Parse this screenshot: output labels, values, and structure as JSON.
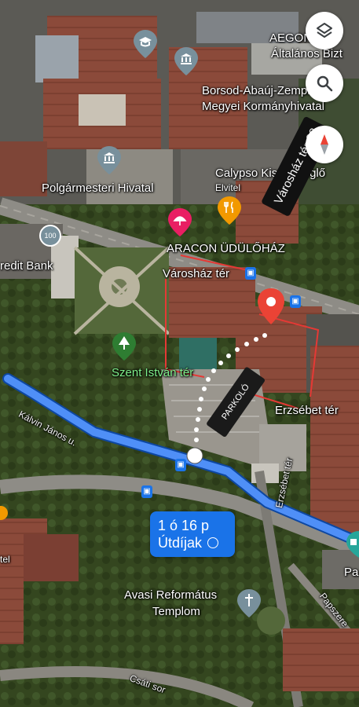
{
  "map": {
    "place_labels": {
      "aego": "AEGON",
      "altalanos": "Általános Bizt",
      "borsod_1": "Borsod-Abaúj-Zemple",
      "borsod_2": "Megyei Kormányhivatal",
      "calypso": "Calypso Kisvendéglő",
      "elvitel": "Elvitel",
      "polgarmesteri": "Polgármesteri Hivatal",
      "aracon": "ARACON ÜDÜLŐHÁZ",
      "varoshaz_ter": "Városház tér",
      "credit_bank": "redit Bank",
      "szent_istvan": "Szent István tér",
      "erzsebet_ter": "Erzsébet tér",
      "avasi_1": "Avasi Református",
      "avasi_2": "Templom",
      "pa": "Pa",
      "tel": "tel"
    },
    "road_labels": {
      "kalvin": "Kálvin János u.",
      "erzsebet_road": "Erzsébet tér",
      "papszer": "Papszere",
      "csati": "Csáti sor"
    },
    "annotations": {
      "varoshaz_22": "Városház tér 22",
      "parkolo": "PARKOLÓ"
    },
    "bank_badge": "100",
    "route": {
      "time": "1 ó 16 p",
      "tolls": "Útdíjak"
    },
    "controls": [
      "layers-icon",
      "search-icon",
      "compass-icon"
    ],
    "colors": {
      "route": "#1a73e8",
      "route_outline": "#0d47a1",
      "destination_pin": "#ea4335",
      "annotation_line": "#e53935",
      "park_label": "#7ef08a",
      "poi_gray": "#78909c",
      "poi_pink": "#e91e63",
      "poi_orange": "#f29900",
      "poi_green": "#2e7d32"
    }
  }
}
